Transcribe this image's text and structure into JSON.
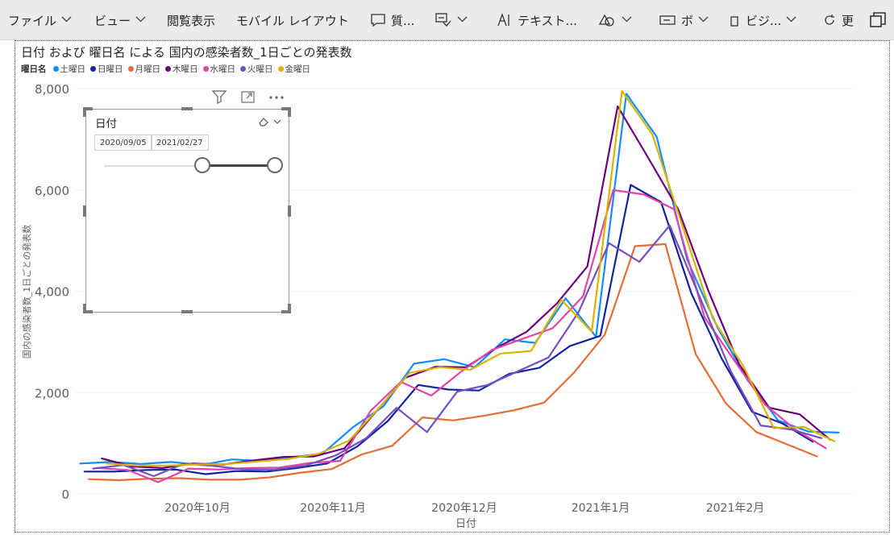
{
  "toolbar": {
    "items": [
      {
        "label": "ファイル",
        "icon": "",
        "chevron": true
      },
      {
        "label": "ビュー",
        "icon": "",
        "chevron": true
      },
      {
        "label": "閲覧表示",
        "icon": "",
        "chevron": false
      },
      {
        "label": "モバイル レイアウト",
        "icon": "",
        "chevron": false
      },
      {
        "label": "質...",
        "icon": "comment-icon",
        "chevron": false
      },
      {
        "label": "",
        "icon": "explain-icon",
        "chevron": true
      },
      {
        "label": "テキスト...",
        "icon": "textbox-icon",
        "chevron": false
      },
      {
        "label": "",
        "icon": "shapes-icon",
        "chevron": true
      },
      {
        "label": "ボ",
        "icon": "button-icon",
        "chevron": true
      },
      {
        "label": "ビジ...",
        "icon": "visual-icon",
        "chevron": true
      },
      {
        "label": "更",
        "icon": "refresh-icon",
        "chevron": false
      }
    ],
    "window_icon": "duplicate-icon"
  },
  "visual": {
    "title": "日付 および 曜日名 による 国内の感染者数_1日ごとの発表数",
    "legend_title": "曜日名",
    "header_icons": [
      "filter-icon",
      "focus-mode-icon",
      "more-options-icon"
    ]
  },
  "slicer": {
    "title": "日付",
    "start_date": "2020/09/05",
    "end_date": "2021/02/27",
    "icons": [
      "eraser-icon",
      "chevron-down-icon"
    ]
  },
  "chart_data": {
    "type": "line",
    "title": "日付 および 曜日名 による 国内の感染者数_1日ごとの発表数",
    "xlabel": "日付",
    "ylabel": "国内の感染者数_1日ごとの発表数",
    "x_ticks": [
      "2020年10月",
      "2020年11月",
      "2020年12月",
      "2021年1月",
      "2021年2月"
    ],
    "y_ticks": [
      "0",
      "2,000",
      "4,000",
      "6,000",
      "8,000"
    ],
    "ylim": [
      0,
      8000
    ],
    "xlim": [
      "2020-09-04",
      "2021-03-03"
    ],
    "grid": "horizontal",
    "legend_position": "top-left",
    "series": [
      {
        "name": "土曜日",
        "color": "#118DFF",
        "x": [
          "2020-09-05",
          "2020-09-12",
          "2020-09-19",
          "2020-09-26",
          "2020-10-03",
          "2020-10-10",
          "2020-10-17",
          "2020-10-24",
          "2020-10-31",
          "2020-11-07",
          "2020-11-14",
          "2020-11-21",
          "2020-11-28",
          "2020-12-05",
          "2020-12-12",
          "2020-12-19",
          "2020-12-26",
          "2021-01-02",
          "2021-01-09",
          "2021-01-16",
          "2021-01-23",
          "2021-01-30",
          "2021-02-06",
          "2021-02-13",
          "2021-02-20",
          "2021-02-27"
        ],
        "values": [
          600,
          630,
          590,
          630,
          570,
          680,
          650,
          720,
          800,
          1320,
          1730,
          2570,
          2660,
          2500,
          3050,
          2980,
          3860,
          3100,
          7900,
          7050,
          4630,
          3290,
          2240,
          1450,
          1230,
          1210
        ]
      },
      {
        "name": "日曜日",
        "color": "#12239E",
        "x": [
          "2020-09-06",
          "2020-09-13",
          "2020-09-20",
          "2020-09-27",
          "2020-10-04",
          "2020-10-11",
          "2020-10-18",
          "2020-10-25",
          "2020-11-01",
          "2020-11-08",
          "2020-11-15",
          "2020-11-22",
          "2020-11-29",
          "2020-12-06",
          "2020-12-13",
          "2020-12-20",
          "2020-12-27",
          "2021-01-03",
          "2021-01-10",
          "2021-01-17",
          "2021-01-24",
          "2021-01-31",
          "2021-02-07",
          "2021-02-14",
          "2021-02-21",
          "2021-02-28"
        ],
        "values": [
          440,
          440,
          470,
          480,
          390,
          450,
          440,
          510,
          600,
          940,
          1440,
          2150,
          2060,
          2040,
          2370,
          2490,
          2920,
          3120,
          6100,
          5760,
          3960,
          2670,
          1620,
          1390,
          1030,
          null
        ]
      },
      {
        "name": "月曜日",
        "color": "#E66C37",
        "x": [
          "2020-09-07",
          "2020-09-14",
          "2020-09-21",
          "2020-09-28",
          "2020-10-05",
          "2020-10-12",
          "2020-10-19",
          "2020-10-26",
          "2020-11-02",
          "2020-11-09",
          "2020-11-16",
          "2020-11-23",
          "2020-11-30",
          "2020-12-07",
          "2020-12-14",
          "2020-12-21",
          "2020-12-28",
          "2021-01-04",
          "2021-01-11",
          "2021-01-18",
          "2021-01-25",
          "2021-02-01",
          "2021-02-08",
          "2021-02-15",
          "2021-02-22"
        ],
        "values": [
          290,
          270,
          300,
          310,
          280,
          280,
          330,
          420,
          490,
          780,
          950,
          1510,
          1450,
          1540,
          1650,
          1800,
          2400,
          3140,
          4890,
          4930,
          2760,
          1780,
          1220,
          980,
          740
        ]
      },
      {
        "name": "木曜日",
        "color": "#6B007B",
        "x": [
          "2020-09-10",
          "2020-09-17",
          "2020-09-24",
          "2020-10-01",
          "2020-10-08",
          "2020-10-15",
          "2020-10-22",
          "2020-10-29",
          "2020-11-05",
          "2020-11-12",
          "2020-11-19",
          "2020-11-26",
          "2020-12-03",
          "2020-12-10",
          "2020-12-17",
          "2020-12-24",
          "2020-12-31",
          "2021-01-07",
          "2021-01-14",
          "2021-01-21",
          "2021-01-28",
          "2021-02-04",
          "2021-02-11",
          "2021-02-18",
          "2021-02-25"
        ],
        "values": [
          700,
          540,
          510,
          600,
          580,
          660,
          730,
          740,
          900,
          1600,
          2290,
          2510,
          2500,
          2880,
          3200,
          3760,
          4490,
          7650,
          6640,
          5610,
          3990,
          2560,
          1700,
          1570,
          1070
        ]
      },
      {
        "name": "水曜日",
        "color": "#E044A7",
        "x": [
          "2020-09-09",
          "2020-09-16",
          "2020-09-23",
          "2020-09-30",
          "2020-10-07",
          "2020-10-14",
          "2020-10-21",
          "2020-10-28",
          "2020-11-04",
          "2020-11-11",
          "2020-11-18",
          "2020-11-25",
          "2020-12-02",
          "2020-12-09",
          "2020-12-16",
          "2020-12-23",
          "2020-12-30",
          "2021-01-06",
          "2021-01-13",
          "2021-01-20",
          "2021-01-27",
          "2021-02-03",
          "2021-02-10",
          "2021-02-17",
          "2021-02-24"
        ],
        "values": [
          510,
          470,
          230,
          500,
          480,
          510,
          520,
          610,
          650,
          1640,
          2210,
          1940,
          2420,
          2840,
          3060,
          3270,
          3900,
          6000,
          5910,
          5620,
          3490,
          2620,
          1760,
          1270,
          900
        ]
      },
      {
        "name": "火曜日",
        "color": "#744EC2",
        "x": [
          "2020-09-08",
          "2020-09-15",
          "2020-09-22",
          "2020-09-29",
          "2020-10-06",
          "2020-10-13",
          "2020-10-20",
          "2020-10-27",
          "2020-11-03",
          "2020-11-10",
          "2020-11-17",
          "2020-11-24",
          "2020-12-01",
          "2020-12-08",
          "2020-12-15",
          "2020-12-22",
          "2020-12-29",
          "2021-01-05",
          "2021-01-12",
          "2021-01-19",
          "2021-01-26",
          "2021-02-02",
          "2021-02-09",
          "2021-02-16",
          "2021-02-23"
        ],
        "values": [
          500,
          570,
          350,
          600,
          550,
          480,
          480,
          560,
          760,
          1100,
          1700,
          1220,
          2020,
          2150,
          2420,
          2690,
          3590,
          4950,
          4580,
          5300,
          3870,
          2440,
          1350,
          1270,
          1100
        ]
      },
      {
        "name": "金曜日",
        "color": "#D9B300",
        "x": [
          "2020-09-11",
          "2020-09-18",
          "2020-09-25",
          "2020-10-02",
          "2020-10-09",
          "2020-10-16",
          "2020-10-23",
          "2020-10-30",
          "2020-11-06",
          "2020-11-13",
          "2020-11-20",
          "2020-11-27",
          "2020-12-04",
          "2020-12-11",
          "2020-12-18",
          "2020-12-25",
          "2021-01-01",
          "2021-01-08",
          "2021-01-15",
          "2021-01-22",
          "2021-01-29",
          "2021-02-05",
          "2021-02-12",
          "2021-02-19",
          "2021-02-26"
        ],
        "values": [
          600,
          560,
          560,
          580,
          590,
          640,
          690,
          790,
          1050,
          1700,
          2390,
          2500,
          2450,
          2770,
          2820,
          3830,
          3200,
          7950,
          7100,
          5270,
          3450,
          2520,
          1300,
          1320,
          1040
        ]
      }
    ]
  }
}
